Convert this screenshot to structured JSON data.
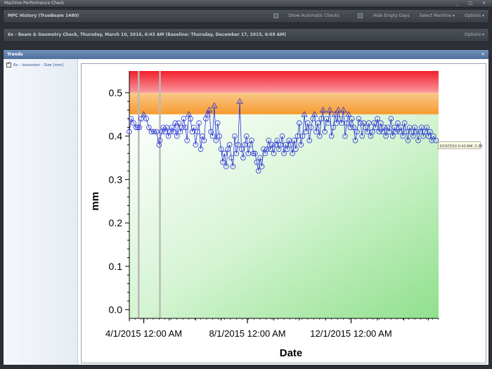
{
  "window": {
    "title": "Machine Performance Check",
    "controls": "_ □ ×"
  },
  "history_bar": {
    "title": "MPC History (TrueBeam 1480)",
    "show_automatic_checks": "Show Automatic Checks",
    "hide_empty_days": "Hide Empty Days",
    "select_machine": "Select Machine ▾",
    "options": "Options ▾"
  },
  "check_bar": {
    "title": "6x - Beam & Geometry Check, Thursday, March 10, 2016, 6:43 AM (Baseline: Thursday, December 17, 2015, 6:09 AM)",
    "options": "Options ▾"
  },
  "trends_panel": {
    "title": "Trends",
    "close": "×",
    "series_label": "6x - Isocenter - Size [mm]"
  },
  "colors": {
    "series": "#2a34d6",
    "band_red": "#f21e2d",
    "band_orange": "#f7a94d",
    "band_green": "#9ce59a"
  },
  "chart_data": {
    "type": "line",
    "xlabel": "Date",
    "ylabel": "mm",
    "ylim": [
      -0.02,
      0.55
    ],
    "xlim": [
      "2015-03-15",
      "2016-03-13"
    ],
    "x_ticks": [
      {
        "date": "2015-04-01",
        "label": "4/1/2015 12:00 AM"
      },
      {
        "date": "2015-08-01",
        "label": "8/1/2015 12:00 AM"
      },
      {
        "date": "2015-12-01",
        "label": "12/1/2015 12:00 AM"
      }
    ],
    "y_ticks": [
      {
        "value": 0.0,
        "label": "0.0"
      },
      {
        "value": 0.1,
        "label": "0.1"
      },
      {
        "value": 0.2,
        "label": "0.2"
      },
      {
        "value": 0.3,
        "label": "0.3"
      },
      {
        "value": 0.4,
        "label": "0.4"
      },
      {
        "value": 0.5,
        "label": "0.5"
      }
    ],
    "bands": [
      {
        "name": "fail",
        "from": 0.5,
        "to": 0.55,
        "color": "#f21e2d"
      },
      {
        "name": "warning",
        "from": 0.45,
        "to": 0.5,
        "color": "#f7a94d"
      },
      {
        "name": "pass",
        "from": -0.02,
        "to": 0.45,
        "color": "#9ce59a"
      }
    ],
    "baseline_markers": [
      "2015-03-26",
      "2015-04-20"
    ],
    "series": [
      {
        "values": [
          [
            "2015-03-15",
            0.41
          ],
          [
            "2015-03-17",
            0.44
          ],
          [
            "2015-03-20",
            0.43
          ],
          [
            "2015-03-23",
            0.42
          ],
          [
            "2015-03-25",
            0.42
          ],
          [
            "2015-03-27",
            0.42
          ],
          [
            "2015-03-29",
            0.44
          ],
          [
            "2015-04-01",
            0.45
          ],
          [
            "2015-04-04",
            0.44
          ],
          [
            "2015-04-07",
            0.42
          ],
          [
            "2015-04-10",
            0.41
          ],
          [
            "2015-04-13",
            0.41
          ],
          [
            "2015-04-16",
            0.41
          ],
          [
            "2015-04-19",
            0.38
          ],
          [
            "2015-04-20",
            0.39
          ],
          [
            "2015-04-22",
            0.41
          ],
          [
            "2015-04-24",
            0.42
          ],
          [
            "2015-04-26",
            0.41
          ],
          [
            "2015-04-28",
            0.42
          ],
          [
            "2015-04-30",
            0.4
          ],
          [
            "2015-05-02",
            0.41
          ],
          [
            "2015-05-04",
            0.42
          ],
          [
            "2015-05-06",
            0.41
          ],
          [
            "2015-05-08",
            0.43
          ],
          [
            "2015-05-10",
            0.4
          ],
          [
            "2015-05-12",
            0.43
          ],
          [
            "2015-05-14",
            0.41
          ],
          [
            "2015-05-16",
            0.42
          ],
          [
            "2015-05-18",
            0.44
          ],
          [
            "2015-05-20",
            0.42
          ],
          [
            "2015-05-22",
            0.39
          ],
          [
            "2015-05-24",
            0.45
          ],
          [
            "2015-05-26",
            0.44
          ],
          [
            "2015-05-28",
            0.41
          ],
          [
            "2015-05-30",
            0.42
          ],
          [
            "2015-06-01",
            0.38
          ],
          [
            "2015-06-03",
            0.41
          ],
          [
            "2015-06-05",
            0.43
          ],
          [
            "2015-06-07",
            0.37
          ],
          [
            "2015-06-09",
            0.4
          ],
          [
            "2015-06-11",
            0.39
          ],
          [
            "2015-06-13",
            0.44
          ],
          [
            "2015-06-15",
            0.45
          ],
          [
            "2015-06-17",
            0.46
          ],
          [
            "2015-06-19",
            0.41
          ],
          [
            "2015-06-21",
            0.4
          ],
          [
            "2015-06-23",
            0.47
          ],
          [
            "2015-06-25",
            0.39
          ],
          [
            "2015-06-27",
            0.43
          ],
          [
            "2015-06-29",
            0.4
          ],
          [
            "2015-07-01",
            0.37
          ],
          [
            "2015-07-03",
            0.34
          ],
          [
            "2015-07-05",
            0.36
          ],
          [
            "2015-07-07",
            0.33
          ],
          [
            "2015-07-09",
            0.37
          ],
          [
            "2015-07-11",
            0.38
          ],
          [
            "2015-07-13",
            0.35
          ],
          [
            "2015-07-15",
            0.33
          ],
          [
            "2015-07-17",
            0.4
          ],
          [
            "2015-07-19",
            0.36
          ],
          [
            "2015-07-21",
            0.38
          ],
          [
            "2015-07-23",
            0.48
          ],
          [
            "2015-07-25",
            0.37
          ],
          [
            "2015-07-27",
            0.35
          ],
          [
            "2015-07-29",
            0.38
          ],
          [
            "2015-07-31",
            0.4
          ],
          [
            "2015-08-02",
            0.36
          ],
          [
            "2015-08-04",
            0.38
          ],
          [
            "2015-08-06",
            0.39
          ],
          [
            "2015-08-08",
            0.36
          ],
          [
            "2015-08-10",
            0.36
          ],
          [
            "2015-08-12",
            0.34
          ],
          [
            "2015-08-14",
            0.32
          ],
          [
            "2015-08-16",
            0.35
          ],
          [
            "2015-08-18",
            0.33
          ],
          [
            "2015-08-20",
            0.37
          ],
          [
            "2015-08-22",
            0.36
          ],
          [
            "2015-08-24",
            0.37
          ],
          [
            "2015-08-26",
            0.39
          ],
          [
            "2015-08-28",
            0.37
          ],
          [
            "2015-08-30",
            0.38
          ],
          [
            "2015-09-01",
            0.36
          ],
          [
            "2015-09-03",
            0.38
          ],
          [
            "2015-09-05",
            0.39
          ],
          [
            "2015-09-07",
            0.37
          ],
          [
            "2015-09-09",
            0.38
          ],
          [
            "2015-09-11",
            0.4
          ],
          [
            "2015-09-13",
            0.36
          ],
          [
            "2015-09-15",
            0.38
          ],
          [
            "2015-09-17",
            0.37
          ],
          [
            "2015-09-19",
            0.39
          ],
          [
            "2015-09-21",
            0.38
          ],
          [
            "2015-09-23",
            0.36
          ],
          [
            "2015-09-25",
            0.39
          ],
          [
            "2015-09-27",
            0.37
          ],
          [
            "2015-09-29",
            0.4
          ],
          [
            "2015-10-01",
            0.43
          ],
          [
            "2015-10-03",
            0.38
          ],
          [
            "2015-10-05",
            0.4
          ],
          [
            "2015-10-07",
            0.45
          ],
          [
            "2015-10-09",
            0.41
          ],
          [
            "2015-10-11",
            0.43
          ],
          [
            "2015-10-13",
            0.39
          ],
          [
            "2015-10-15",
            0.42
          ],
          [
            "2015-10-17",
            0.44
          ],
          [
            "2015-10-19",
            0.45
          ],
          [
            "2015-10-21",
            0.41
          ],
          [
            "2015-10-23",
            0.43
          ],
          [
            "2015-10-25",
            0.4
          ],
          [
            "2015-10-27",
            0.44
          ],
          [
            "2015-10-29",
            0.46
          ],
          [
            "2015-10-31",
            0.41
          ],
          [
            "2015-11-02",
            0.44
          ],
          [
            "2015-11-04",
            0.43
          ],
          [
            "2015-11-06",
            0.46
          ],
          [
            "2015-11-08",
            0.4
          ],
          [
            "2015-11-10",
            0.42
          ],
          [
            "2015-11-12",
            0.45
          ],
          [
            "2015-11-14",
            0.43
          ],
          [
            "2015-11-16",
            0.46
          ],
          [
            "2015-11-18",
            0.44
          ],
          [
            "2015-11-20",
            0.43
          ],
          [
            "2015-11-22",
            0.46
          ],
          [
            "2015-11-24",
            0.4
          ],
          [
            "2015-11-26",
            0.43
          ],
          [
            "2015-11-28",
            0.45
          ],
          [
            "2015-11-30",
            0.42
          ],
          [
            "2015-12-02",
            0.44
          ],
          [
            "2015-12-04",
            0.42
          ],
          [
            "2015-12-06",
            0.39
          ],
          [
            "2015-12-08",
            0.41
          ],
          [
            "2015-12-10",
            0.44
          ],
          [
            "2015-12-12",
            0.43
          ],
          [
            "2015-12-14",
            0.4
          ],
          [
            "2015-12-16",
            0.43
          ],
          [
            "2015-12-18",
            0.42
          ],
          [
            "2015-12-20",
            0.41
          ],
          [
            "2015-12-22",
            0.43
          ],
          [
            "2015-12-24",
            0.4
          ],
          [
            "2015-12-26",
            0.41
          ],
          [
            "2015-12-28",
            0.43
          ],
          [
            "2015-12-30",
            0.42
          ],
          [
            "2016-01-01",
            0.44
          ],
          [
            "2016-01-03",
            0.41
          ],
          [
            "2016-01-05",
            0.43
          ],
          [
            "2016-01-07",
            0.41
          ],
          [
            "2016-01-09",
            0.42
          ],
          [
            "2016-01-11",
            0.4
          ],
          [
            "2016-01-13",
            0.42
          ],
          [
            "2016-01-15",
            0.41
          ],
          [
            "2016-01-17",
            0.44
          ],
          [
            "2016-01-19",
            0.4
          ],
          [
            "2016-01-21",
            0.42
          ],
          [
            "2016-01-23",
            0.41
          ],
          [
            "2016-01-25",
            0.43
          ],
          [
            "2016-01-27",
            0.41
          ],
          [
            "2016-01-29",
            0.42
          ],
          [
            "2016-01-31",
            0.4
          ],
          [
            "2016-02-02",
            0.43
          ],
          [
            "2016-02-04",
            0.41
          ],
          [
            "2016-02-06",
            0.39
          ],
          [
            "2016-02-08",
            0.42
          ],
          [
            "2016-02-10",
            0.41
          ],
          [
            "2016-02-12",
            0.4
          ],
          [
            "2016-02-14",
            0.42
          ],
          [
            "2016-02-16",
            0.41
          ],
          [
            "2016-02-18",
            0.39
          ],
          [
            "2016-02-20",
            0.41
          ],
          [
            "2016-02-22",
            0.42
          ],
          [
            "2016-02-24",
            0.4
          ],
          [
            "2016-02-26",
            0.41
          ],
          [
            "2016-02-28",
            0.42
          ],
          [
            "2016-03-01",
            0.4
          ],
          [
            "2016-03-03",
            0.41
          ],
          [
            "2016-03-05",
            0.39
          ],
          [
            "2016-03-07",
            0.4
          ],
          [
            "2016-03-10",
            0.39
          ]
        ]
      }
    ],
    "tooltip": "3/10/2016 6:43 AM, 0.39"
  }
}
